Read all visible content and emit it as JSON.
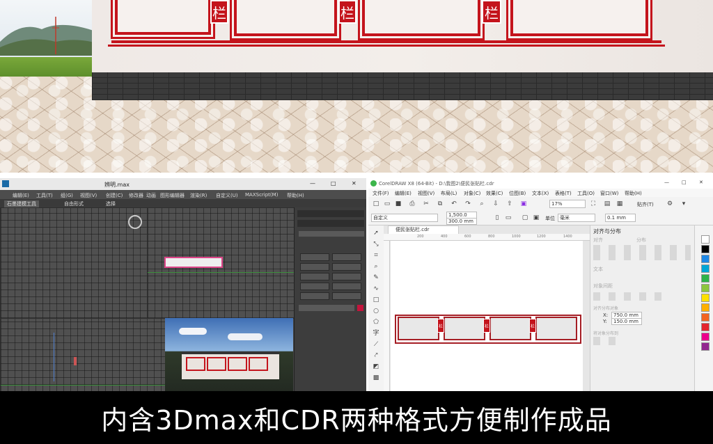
{
  "render": {
    "wall_tag_char": "栏",
    "frame_color": "#c4141c"
  },
  "max": {
    "window_title": "辨明.max",
    "window_buttons": [
      "—",
      "□",
      "✕"
    ],
    "menu": [
      "编辑(E)",
      "工具(T)",
      "组(G)",
      "视图(V)",
      "创建(C)",
      "修改器",
      "动画",
      "图形编辑器",
      "渲染(R)",
      "自定义(U)",
      "MAXScript(M)",
      "帮助(H)"
    ],
    "ribbon": [
      "石墨建模工具",
      "自由形式",
      "选择"
    ],
    "panel_buttons": [
      "长方体",
      "圆锥体",
      "球体",
      "几何球体",
      "圆柱体",
      "管状体",
      "圆环",
      "四棱锥",
      "茶壶",
      "平面"
    ]
  },
  "cdr": {
    "window_title": "CorelDRAW X8 (64-Bit) - D:\\我图2\\便民张贴栏.cdr",
    "window_buttons": [
      "—",
      "□",
      "✕"
    ],
    "menu": [
      "文件(F)",
      "编辑(E)",
      "视图(V)",
      "布局(L)",
      "对象(C)",
      "效果(C)",
      "位图(B)",
      "文本(X)",
      "表格(T)",
      "工具(O)",
      "窗口(W)",
      "帮助(H)"
    ],
    "zoom": "17%",
    "snap_label": "贴齐(T)",
    "page_preset": "自定义",
    "page_width": "1,500.0 mm",
    "page_height": "300.0 mm",
    "unit_label": "单位",
    "unit_value": "毫米",
    "nudge": "0.1 mm",
    "doc_tab": "便民张贴栏.cdr",
    "ruler_ticks": [
      "200",
      "400",
      "600",
      "800",
      "1000",
      "1200",
      "1400"
    ],
    "tag_char": "栏",
    "docker_title": "对齐与分布",
    "docker_align": "对齐",
    "docker_distribute": "分布",
    "docker_text": "文本",
    "docker_object_spacing": "对象间距",
    "docker_bbox": "对齐分布对象",
    "x_label": "X:",
    "x_value": "750.0 mm",
    "y_label": "Y:",
    "y_value": "150.0 mm",
    "docker_extra": "将对象分布到",
    "palette_colors": [
      "#ffffff",
      "#000000",
      "#1e88e5",
      "#00a6d6",
      "#2eb34a",
      "#8cc63e",
      "#ffe000",
      "#ffb000",
      "#f26522",
      "#e3262f",
      "#ec008c",
      "#92278f"
    ]
  },
  "caption": "内含3Dmax和CDR两种格式方便制作成品"
}
